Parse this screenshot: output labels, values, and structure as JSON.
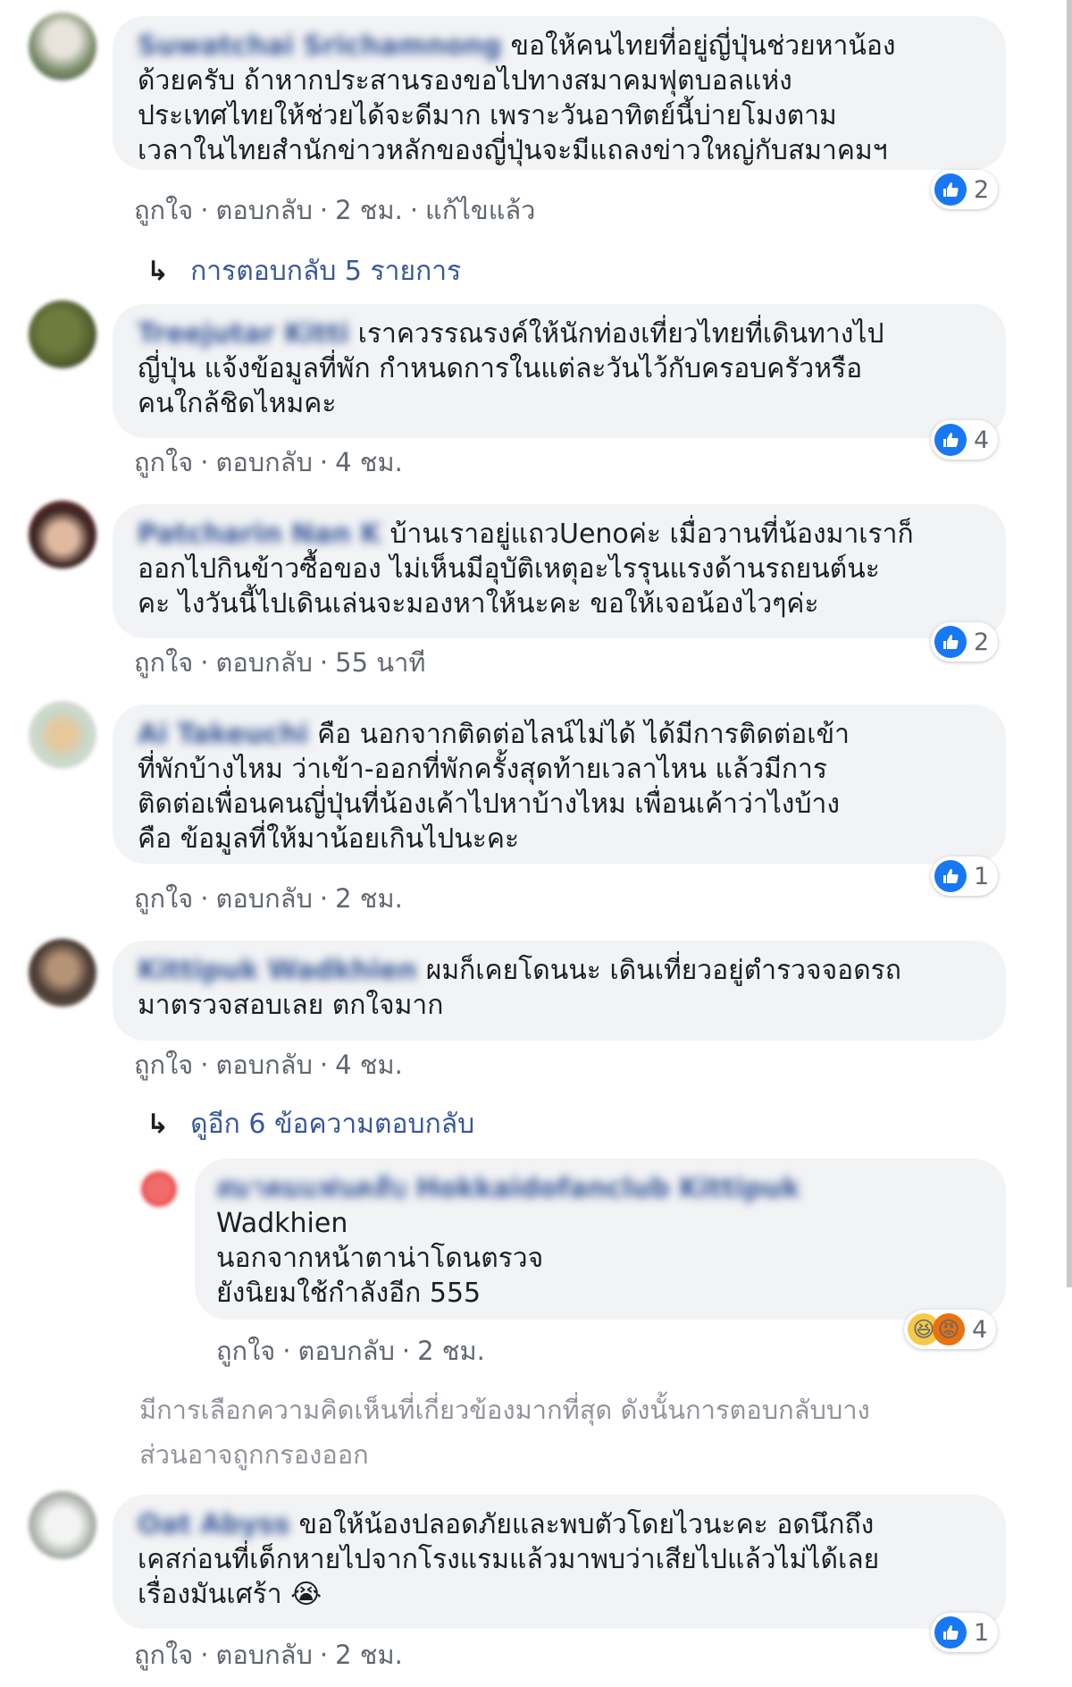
{
  "comments": [
    {
      "name": "Suwatchai Srichamnong",
      "lines": [
        "ขอให้คนไทยที่อยู่ญี่ปุ่นช่วยหาน้อง",
        "ด้วยครับ ถ้าหากประสานรองขอไปทางสมาคมฟุตบอลแห่ง",
        "ประเทศไทยให้ช่วยได้จะดีมาก เพราะวันอาทิตย์นี้บ่ายโมงตาม",
        "เวลาในไทยสำนักข่าวหลักของญี่ปุ่นจะมีแถลงข่าวใหญ่กับสมาคมฯ"
      ],
      "like": "ถูกใจ",
      "reply": "ตอบกลับ",
      "time": "2 ชม.",
      "edited": "แก้ไขแล้ว",
      "reactions": "2"
    },
    {
      "name": "Treejutar Kitti",
      "lines": [
        "เราควรรณรงค์ให้นักท่องเที่ยวไทยที่เดินทางไป",
        "ญี่ปุ่น แจ้งข้อมูลที่พัก กำหนดการในแต่ละวันไว้กับครอบครัวหรือ",
        "คนใกล้ชิดไหมคะ"
      ],
      "like": "ถูกใจ",
      "reply": "ตอบกลับ",
      "time": "4 ชม.",
      "reactions": "4"
    },
    {
      "name": "Patcharin Nan K",
      "lines": [
        "บ้านเราอยู่แถวUenoค่ะ เมื่อวานที่น้องมาเราก็",
        "ออกไปกินข้าวซื้อของ ไม่เห็นมีอุบัติเหตุอะไรรุนแรงด้านรถยนต์นะ",
        "คะ ไงวันนี้ไปเดินเล่นจะมองหาให้นะคะ ขอให้เจอน้องไวๆค่ะ"
      ],
      "like": "ถูกใจ",
      "reply": "ตอบกลับ",
      "time": "55 นาที",
      "reactions": "2"
    },
    {
      "name": "Ai Takeuchi",
      "lines": [
        "คือ นอกจากติดต่อไลน์ไม่ได้ ได้มีการติดต่อเข้า",
        "ที่พักบ้างไหม ว่าเข้า-ออกที่พักครั้งสุดท้ายเวลาไหน แล้วมีการ",
        "ติดต่อเพื่อนคนญี่ปุ่นที่น้องเค้าไปหาบ้างไหม เพื่อนเค้าว่าไงบ้าง",
        "คือ ข้อมูลที่ให้มาน้อยเกินไปนะคะ"
      ],
      "like": "ถูกใจ",
      "reply": "ตอบกลับ",
      "time": "2 ชม.",
      "reactions": "1"
    },
    {
      "name": "Kittipuk Wadkhien",
      "lines": [
        "ผมก็เคยโดนนะ เดินเที่ยวอยู่ตำรวจจอดรถ",
        "มาตรวจสอบเลย ตกใจมาก"
      ],
      "like": "ถูกใจ",
      "reply": "ตอบกลับ",
      "time": "4 ชม."
    },
    {
      "name": "Oat Abyss",
      "lines": [
        "ขอให้น้องปลอดภัยและพบตัวโดยไวนะคะ อดนึกถึง",
        "เคสก่อนที่เด็กหายไปจากโรงแรมแล้วมาพบว่าเสียไปแล้วไม่ได้เลย",
        "เรื่องมันเศร้า"
      ],
      "emoji": "😭",
      "like": "ถูกใจ",
      "reply": "ตอบกลับ",
      "time": "2 ชม.",
      "reactions": "1"
    }
  ],
  "reply_links": {
    "first": "การตอบกลับ 5 รายการ",
    "second": "ดูอีก 6 ข้อความตอบกลับ"
  },
  "nested_reply": {
    "name": "สมาคมแฟนคลับ Hokkaidofanclub Kittipuk",
    "lines": [
      "Wadkhien",
      "นอกจากหน้าตาน่าโดนตรวจ",
      "ยังนิยมใช้กำลังอีก 555"
    ],
    "like": "ถูกใจ",
    "reply": "ตอบกลับ",
    "time": "2 ชม.",
    "reactions": "4"
  },
  "notice": {
    "line1": "มีการเลือกความคิดเห็นที่เกี่ยวข้องมากที่สุด ดังนั้นการตอบกลับบาง",
    "line2": "ส่วนอาจถูกกรองออก"
  },
  "colors": {
    "link": "#385898",
    "like": "#1877f2",
    "bubble": "#f2f3f5",
    "muted": "#616770"
  }
}
